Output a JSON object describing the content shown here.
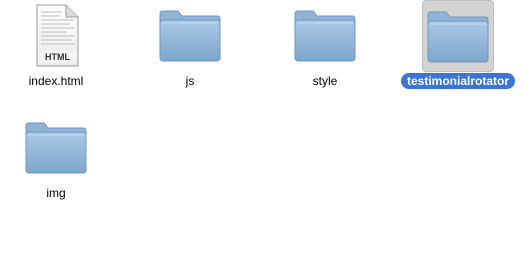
{
  "selection_color": "#3875d7",
  "folder_color": "#8fb4d6",
  "items": [
    {
      "label": "index.html",
      "kind": "html-document-icon",
      "badge": "HTML",
      "selected": false
    },
    {
      "label": "js",
      "kind": "folder-icon",
      "selected": false
    },
    {
      "label": "style",
      "kind": "folder-icon",
      "selected": false
    },
    {
      "label": "testimonialrotator",
      "kind": "folder-icon",
      "selected": true
    },
    {
      "label": "img",
      "kind": "folder-icon",
      "selected": false
    }
  ]
}
